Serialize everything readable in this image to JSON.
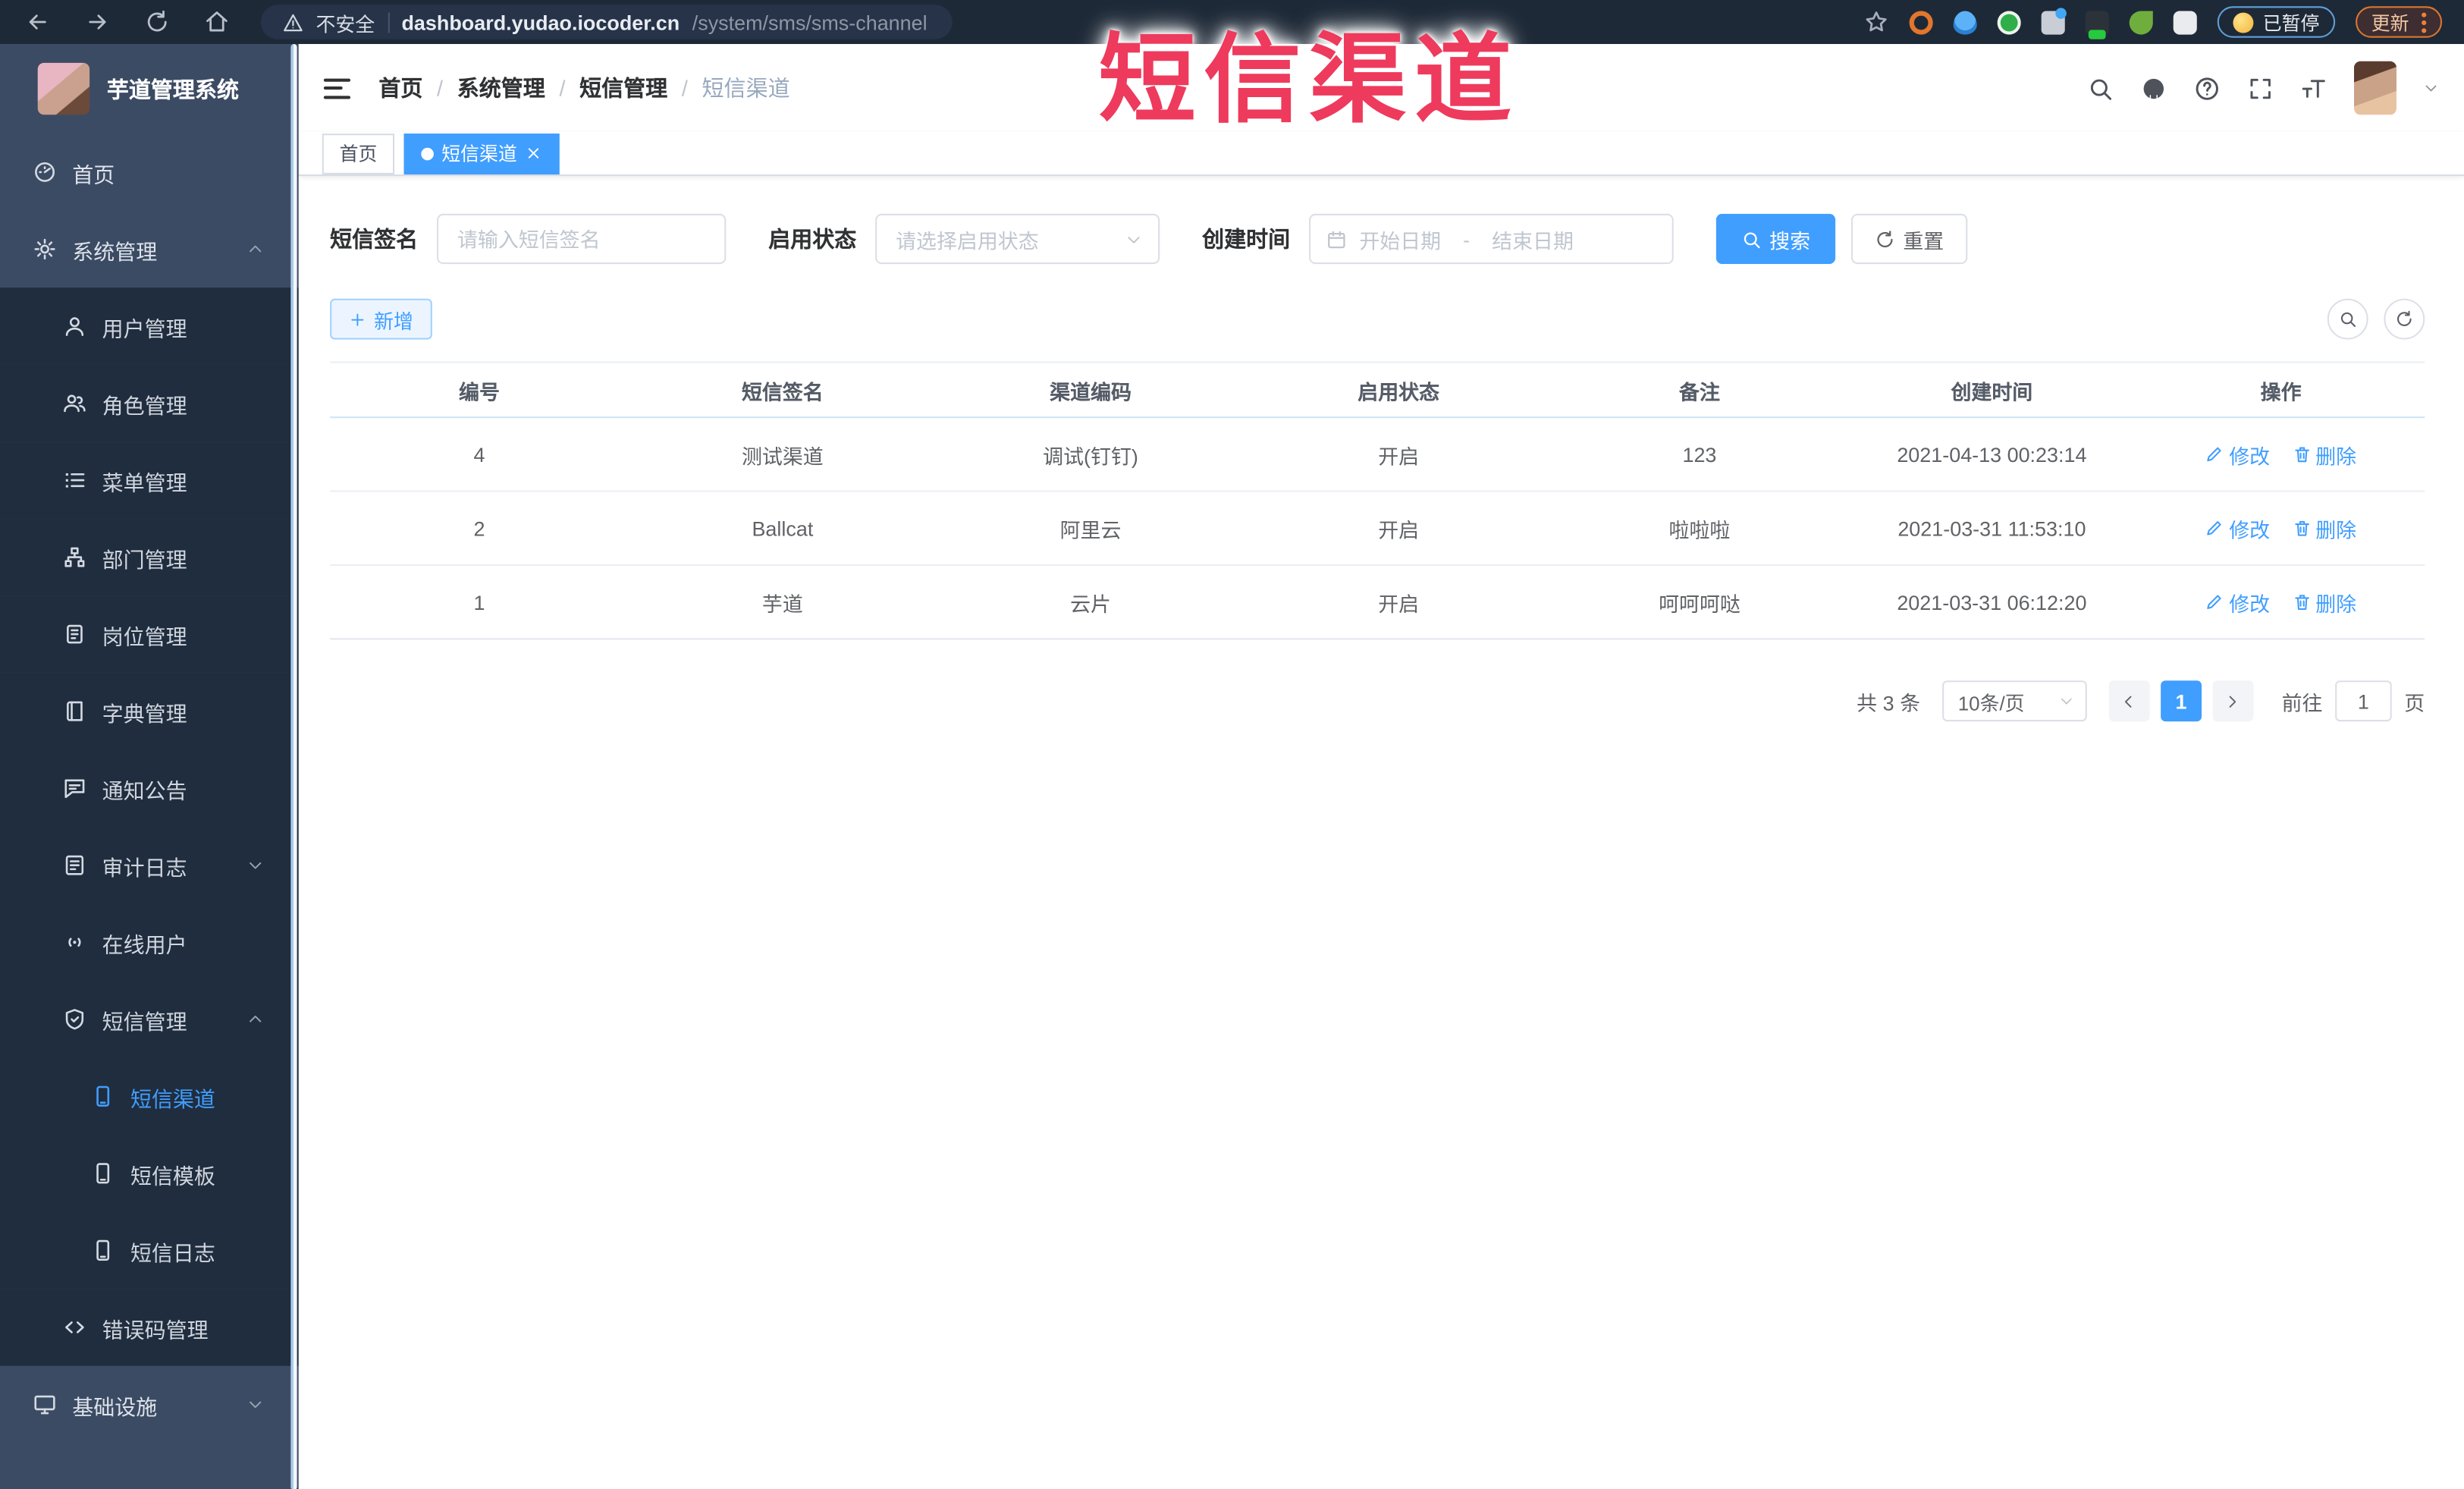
{
  "browser": {
    "security_label": "不安全",
    "url_host": "dashboard.yudao.iocoder.cn",
    "url_path": "/system/sms/sms-channel",
    "paused_badge": "已暂停",
    "update_button": "更新",
    "extensions": [
      {
        "name": "ext-orange-ring-icon",
        "type": "ring"
      },
      {
        "name": "ext-blue-pin-icon",
        "type": "pin"
      },
      {
        "name": "ext-green-check-icon",
        "type": "check"
      },
      {
        "name": "ext-gray-blue-dot-icon",
        "type": "dot"
      },
      {
        "name": "ext-dark-on-badge-icon",
        "type": "dark-on"
      },
      {
        "name": "ext-green-leaf-icon",
        "type": "leaf"
      },
      {
        "name": "ext-white-puzzle-icon",
        "type": "puzzle"
      }
    ]
  },
  "annotation_text": "短信渠道",
  "app_title": "芋道管理系统",
  "sidebar": {
    "items": [
      {
        "key": "home",
        "label": "首页",
        "icon": "gauge",
        "level": 1,
        "dark": false
      },
      {
        "key": "system",
        "label": "系统管理",
        "icon": "gear",
        "level": 1,
        "dark": false,
        "arrow": "up"
      },
      {
        "key": "user",
        "label": "用户管理",
        "icon": "user",
        "level": 2,
        "dark": true
      },
      {
        "key": "role",
        "label": "角色管理",
        "icon": "users",
        "level": 2,
        "dark": true
      },
      {
        "key": "menu",
        "label": "菜单管理",
        "icon": "list",
        "level": 2,
        "dark": true
      },
      {
        "key": "dept",
        "label": "部门管理",
        "icon": "tree",
        "level": 2,
        "dark": true
      },
      {
        "key": "post",
        "label": "岗位管理",
        "icon": "badge",
        "level": 2,
        "dark": true
      },
      {
        "key": "dict",
        "label": "字典管理",
        "icon": "book",
        "level": 2,
        "dark": true
      },
      {
        "key": "notice",
        "label": "通知公告",
        "icon": "chat",
        "level": 2,
        "dark": true
      },
      {
        "key": "audit-log",
        "label": "审计日志",
        "icon": "log",
        "level": 2,
        "dark": true,
        "arrow": "down"
      },
      {
        "key": "online-user",
        "label": "在线用户",
        "icon": "signal",
        "level": 2,
        "dark": true
      },
      {
        "key": "sms",
        "label": "短信管理",
        "icon": "shield",
        "level": 2,
        "dark": true,
        "arrow": "up"
      },
      {
        "key": "sms-channel",
        "label": "短信渠道",
        "icon": "phone",
        "level": 3,
        "dark": true,
        "active": true
      },
      {
        "key": "sms-template",
        "label": "短信模板",
        "icon": "phone",
        "level": 3,
        "dark": true
      },
      {
        "key": "sms-log",
        "label": "短信日志",
        "icon": "phone",
        "level": 3,
        "dark": true
      },
      {
        "key": "error-code",
        "label": "错误码管理",
        "icon": "code",
        "level": 2,
        "dark": true
      },
      {
        "key": "infra",
        "label": "基础设施",
        "icon": "monitor",
        "level": 1,
        "dark": false,
        "arrow": "down"
      }
    ]
  },
  "header": {
    "breadcrumb": [
      "首页",
      "系统管理",
      "短信管理",
      "短信渠道"
    ],
    "breadcrumb_separator": "/"
  },
  "tabs": [
    {
      "key": "home",
      "label": "首页",
      "active": false,
      "closable": false
    },
    {
      "key": "sms-channel",
      "label": "短信渠道",
      "active": true,
      "closable": true
    }
  ],
  "filters": {
    "sign_label": "短信签名",
    "sign_placeholder": "请输入短信签名",
    "status_label": "启用状态",
    "status_placeholder": "请选择启用状态",
    "time_label": "创建时间",
    "start_placeholder": "开始日期",
    "range_separator": "-",
    "end_placeholder": "结束日期",
    "search_label": "搜索",
    "reset_label": "重置"
  },
  "toolbar": {
    "add_label": "新增"
  },
  "table": {
    "columns": [
      "编号",
      "短信签名",
      "渠道编码",
      "启用状态",
      "备注",
      "创建时间",
      "操作"
    ],
    "edit_label": "修改",
    "delete_label": "删除",
    "rows": [
      {
        "id": "4",
        "sign": "测试渠道",
        "code": "调试(钉钉)",
        "status": "开启",
        "remark": "123",
        "created": "2021-04-13 00:23:14"
      },
      {
        "id": "2",
        "sign": "Ballcat",
        "code": "阿里云",
        "status": "开启",
        "remark": "啦啦啦",
        "created": "2021-03-31 11:53:10"
      },
      {
        "id": "1",
        "sign": "芋道",
        "code": "云片",
        "status": "开启",
        "remark": "呵呵呵哒",
        "created": "2021-03-31 06:12:20"
      }
    ]
  },
  "pagination": {
    "total_label": "共 3 条",
    "page_size": "10条/页",
    "current_page": "1",
    "goto_label": "前往",
    "goto_value": "1",
    "page_unit": "页"
  },
  "colors": {
    "accent_blue": "#409eff",
    "annotation_red": "#ee3a5c",
    "sidebar_bg": "#3c4b64",
    "sidebar_submenu_bg": "#202d3e",
    "browser_bar_bg": "#1e2937"
  }
}
